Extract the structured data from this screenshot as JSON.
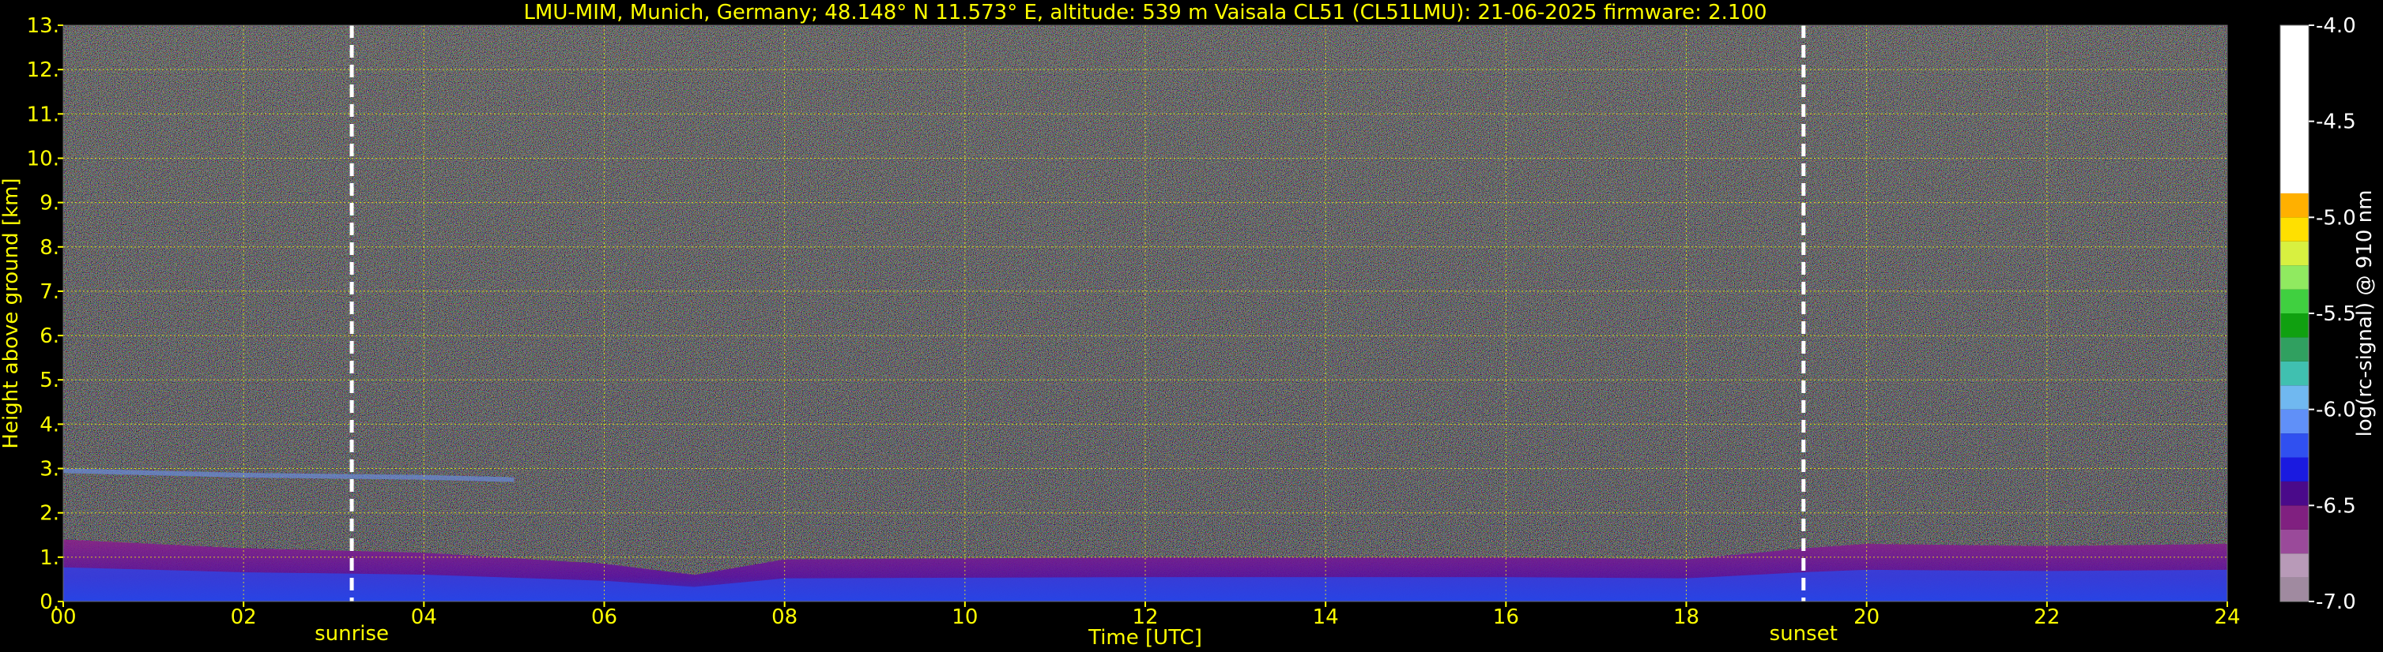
{
  "chart_data": {
    "type": "heatmap",
    "title": "LMU-MIM, Munich, Germany; 48.148° N 11.573° E, altitude: 539 m    Vaisala CL51 (CL51LMU): 21-06-2025    firmware: 2.100",
    "xlabel": "Time [UTC]",
    "ylabel": "Height above ground [km]",
    "xlim": [
      0,
      24
    ],
    "ylim": [
      0,
      13
    ],
    "x_ticks": [
      "00",
      "02",
      "04",
      "06",
      "08",
      "10",
      "12",
      "14",
      "16",
      "18",
      "20",
      "22",
      "24"
    ],
    "y_ticks": [
      "0.",
      "1.",
      "2.",
      "3.",
      "4.",
      "5.",
      "6.",
      "7.",
      "8.",
      "9.",
      "10.",
      "11.",
      "12.",
      "13."
    ],
    "grid": true,
    "grid_color": "#ffff00",
    "annotations": [
      {
        "label": "sunrise",
        "x": 3.2
      },
      {
        "label": "sunset",
        "x": 19.3
      }
    ],
    "mixed_layer_height_km": {
      "time": [
        0,
        2,
        4,
        6,
        7,
        8,
        12,
        16,
        18,
        19.3,
        20,
        22,
        24
      ],
      "height": [
        1.4,
        1.2,
        1.1,
        0.85,
        0.6,
        0.95,
        1.0,
        1.0,
        0.95,
        1.2,
        1.3,
        1.25,
        1.3
      ]
    },
    "residual_layer_top_km": {
      "time": [
        0,
        2,
        4,
        5
      ],
      "height": [
        2.95,
        2.85,
        2.8,
        2.75
      ]
    },
    "colorbar": {
      "label": "log(rc-signal) @ 910 nm",
      "range": [
        -7.0,
        -4.0
      ],
      "ticks": [
        "-4.0",
        "-4.5",
        "-5.0",
        "-5.5",
        "-6.0",
        "-6.5",
        "-7.0"
      ],
      "colors": [
        "#a08aa0",
        "#b89ab8",
        "#9a4a9a",
        "#802080",
        "#4a0a8a",
        "#1a1ae0",
        "#3050f0",
        "#6090f8",
        "#70b8f0",
        "#40c0b0",
        "#30a060",
        "#10a010",
        "#40d040",
        "#90ea60",
        "#d8f040",
        "#ffe000",
        "#ffb000",
        "#ff7800",
        "#ff3800",
        "#e00000",
        "#f0b0b0",
        "#ffe0e0",
        "#ffffff"
      ]
    }
  }
}
